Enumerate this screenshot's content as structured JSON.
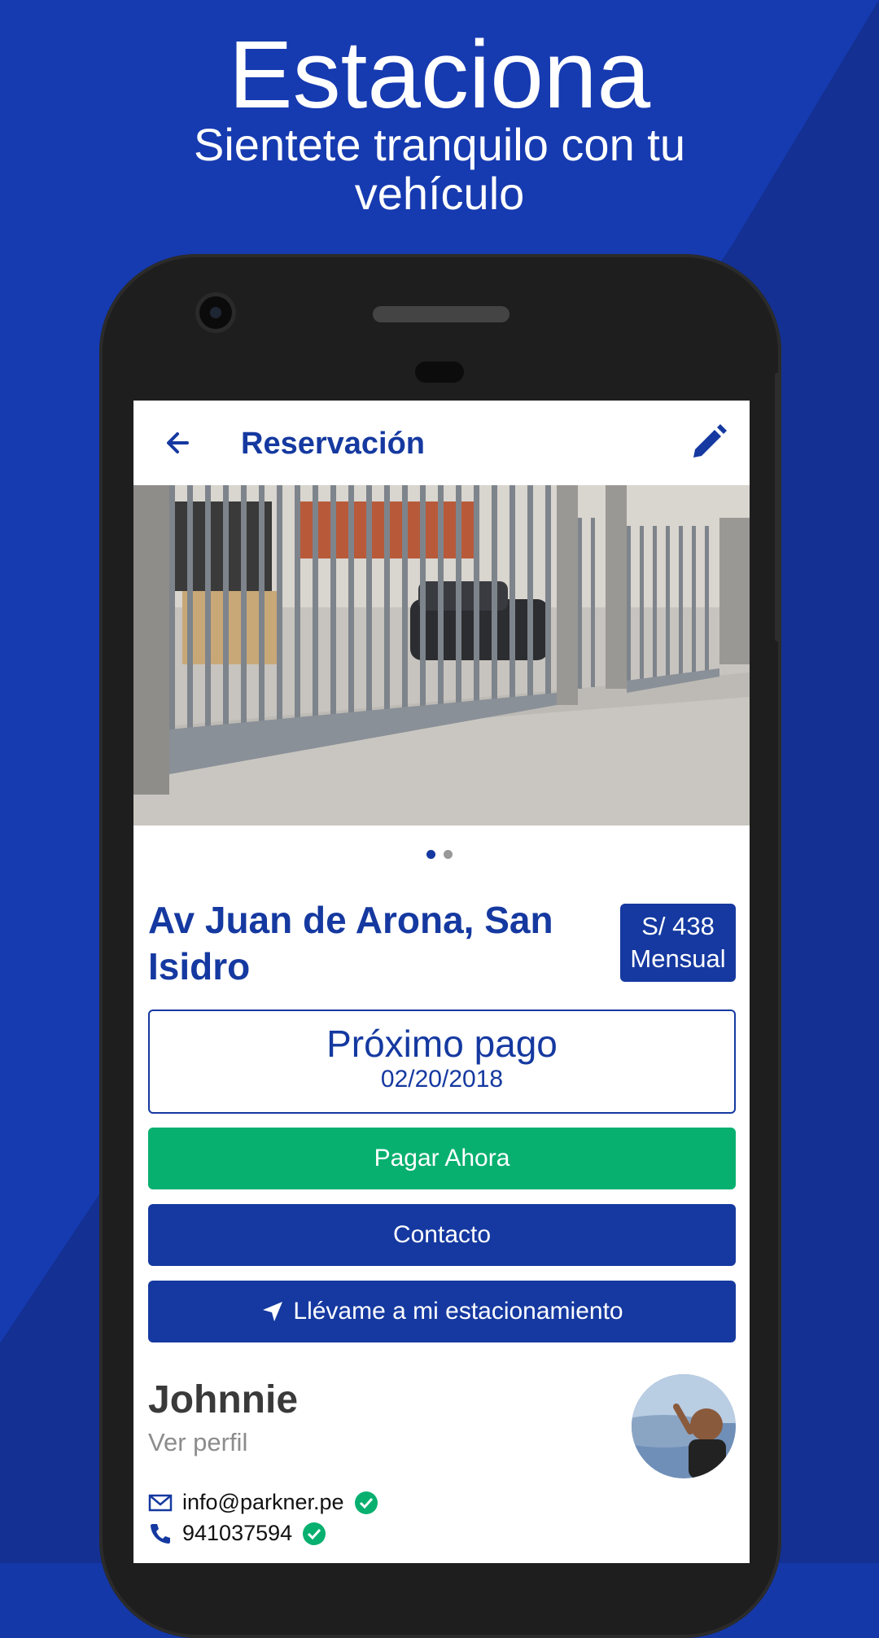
{
  "promo": {
    "title": "Estaciona",
    "subtitle": "Sientete tranquilo con tu vehículo"
  },
  "appbar": {
    "title": "Reservación",
    "back_icon": "arrow-left-icon",
    "edit_icon": "pencil-icon"
  },
  "carousel": {
    "total": 2,
    "active_index": 0
  },
  "listing": {
    "address": "Av Juan de Arona, San Isidro",
    "price": "S/ 438",
    "period": "Mensual"
  },
  "payment": {
    "label": "Próximo pago",
    "date": "02/20/2018"
  },
  "actions": {
    "pay": "Pagar Ahora",
    "contact": "Contacto",
    "navigate": "Llévame a mi estacionamiento"
  },
  "owner": {
    "name": "Johnnie",
    "profile_link": "Ver perfil",
    "email": "info@parkner.pe",
    "phone": "941037594"
  },
  "colors": {
    "primary": "#1539a0",
    "success": "#08b070",
    "background": "#1538a8"
  }
}
